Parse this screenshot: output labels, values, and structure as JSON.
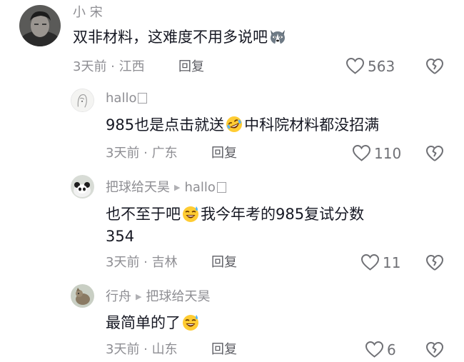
{
  "comments": [
    {
      "user": "小 宋",
      "text": "双非材料，这难度不用多说吧",
      "emoji": "husky-emoji",
      "meta": "3天前 · 江西",
      "reply_label": "回复",
      "likes": "563"
    },
    {
      "user": "hallo",
      "text_before": "985也是点击就送",
      "emoji": "rofl-emoji",
      "text_after": "中科院材料都没招满",
      "meta": "3天前 · 广东",
      "reply_label": "回复",
      "likes": "110"
    },
    {
      "user": "把球给天昊",
      "reply_to": "hallo",
      "text_before": "也不至于吧",
      "emoji": "sweat-smile-emoji",
      "text_after": "我今年考的985复试分数",
      "text_line2": "354",
      "meta": "3天前 · 吉林",
      "reply_label": "回复",
      "likes": "11"
    },
    {
      "user": "行舟",
      "reply_to": "把球给天昊",
      "text_before": "最简单的了",
      "emoji": "sweat-smile-emoji",
      "meta": "3天前 · 山东",
      "reply_label": "回复",
      "likes": "6"
    }
  ],
  "colors": {
    "text": "#161823",
    "secondary": "#8e8e93",
    "icon": "#6f7075"
  }
}
